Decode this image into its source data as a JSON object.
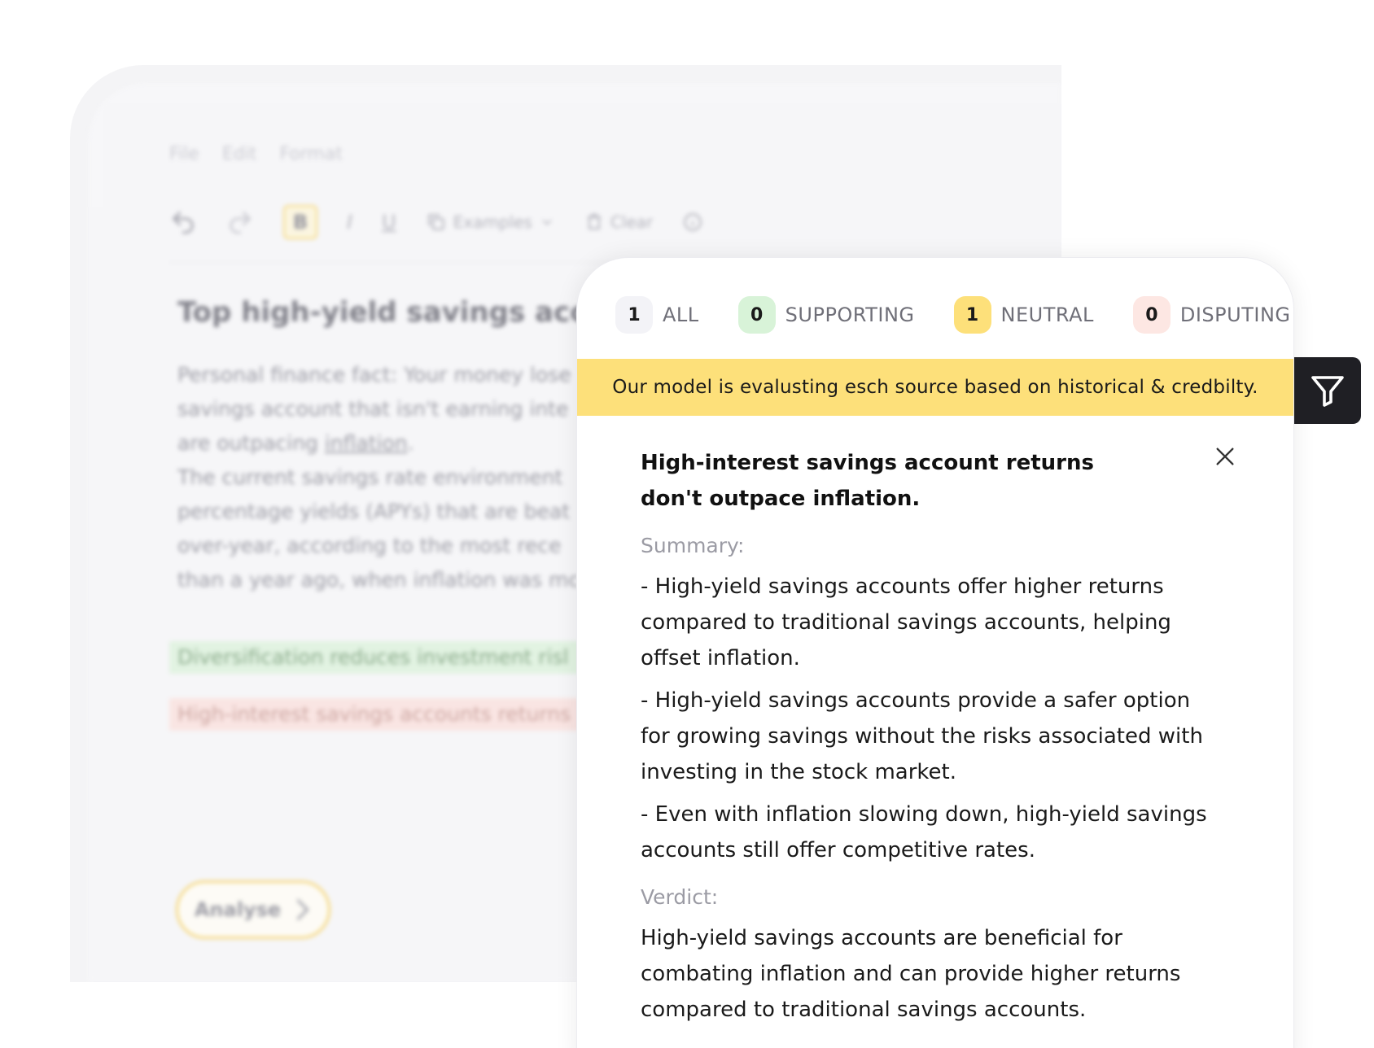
{
  "editor": {
    "menu": [
      "File",
      "Edit",
      "Format"
    ],
    "toolbar": {
      "bold": "B",
      "italic": "I",
      "underline": "U",
      "examples": "Examples",
      "clear": "Clear"
    },
    "title": "Top high-yield savings accou",
    "body_lines": [
      "Personal finance fact: Your money lose",
      "savings account that isn't earning inte",
      "are outpacing ",
      "The current savings rate environment ",
      "percentage yields (APYs) that are beat",
      "over-year, according to the most rece",
      "than a year ago, when inflation was mc"
    ],
    "body_link": "inflation",
    "highlight_supporting": "Diversification reduces investment risl",
    "highlight_disputing": "High-interest savings accounts returns",
    "analyse_label": "Analyse"
  },
  "panel": {
    "tabs": [
      {
        "count": "1",
        "label": "ALL"
      },
      {
        "count": "0",
        "label": "SUPPORTING"
      },
      {
        "count": "1",
        "label": "NEUTRAL"
      },
      {
        "count": "0",
        "label": "DISPUTING"
      }
    ],
    "banner": "Our model is evalusting esch source based on historical & credbilty.",
    "claim": "High-interest savings account returns don't outpace inflation.",
    "summary_label": "Summary:",
    "summary": [
      "- High-yield savings accounts offer higher returns compared to traditional savings accounts, helping offset inflation.",
      "- High-yield savings accounts provide a safer option for growing savings without the risks associated with investing in the stock market.",
      "- Even with inflation slowing down, high-yield savings accounts still offer competitive rates."
    ],
    "verdict_label": "Verdict:",
    "verdict": "High-yield savings accounts are beneficial for combating inflation and can provide higher returns compared to traditional savings accounts."
  },
  "colors": {
    "accent_yellow": "#fde07a",
    "supporting_green": "#d8f3d8",
    "disputing_red": "#fde7e3",
    "filter_bg": "#1f1f24"
  }
}
